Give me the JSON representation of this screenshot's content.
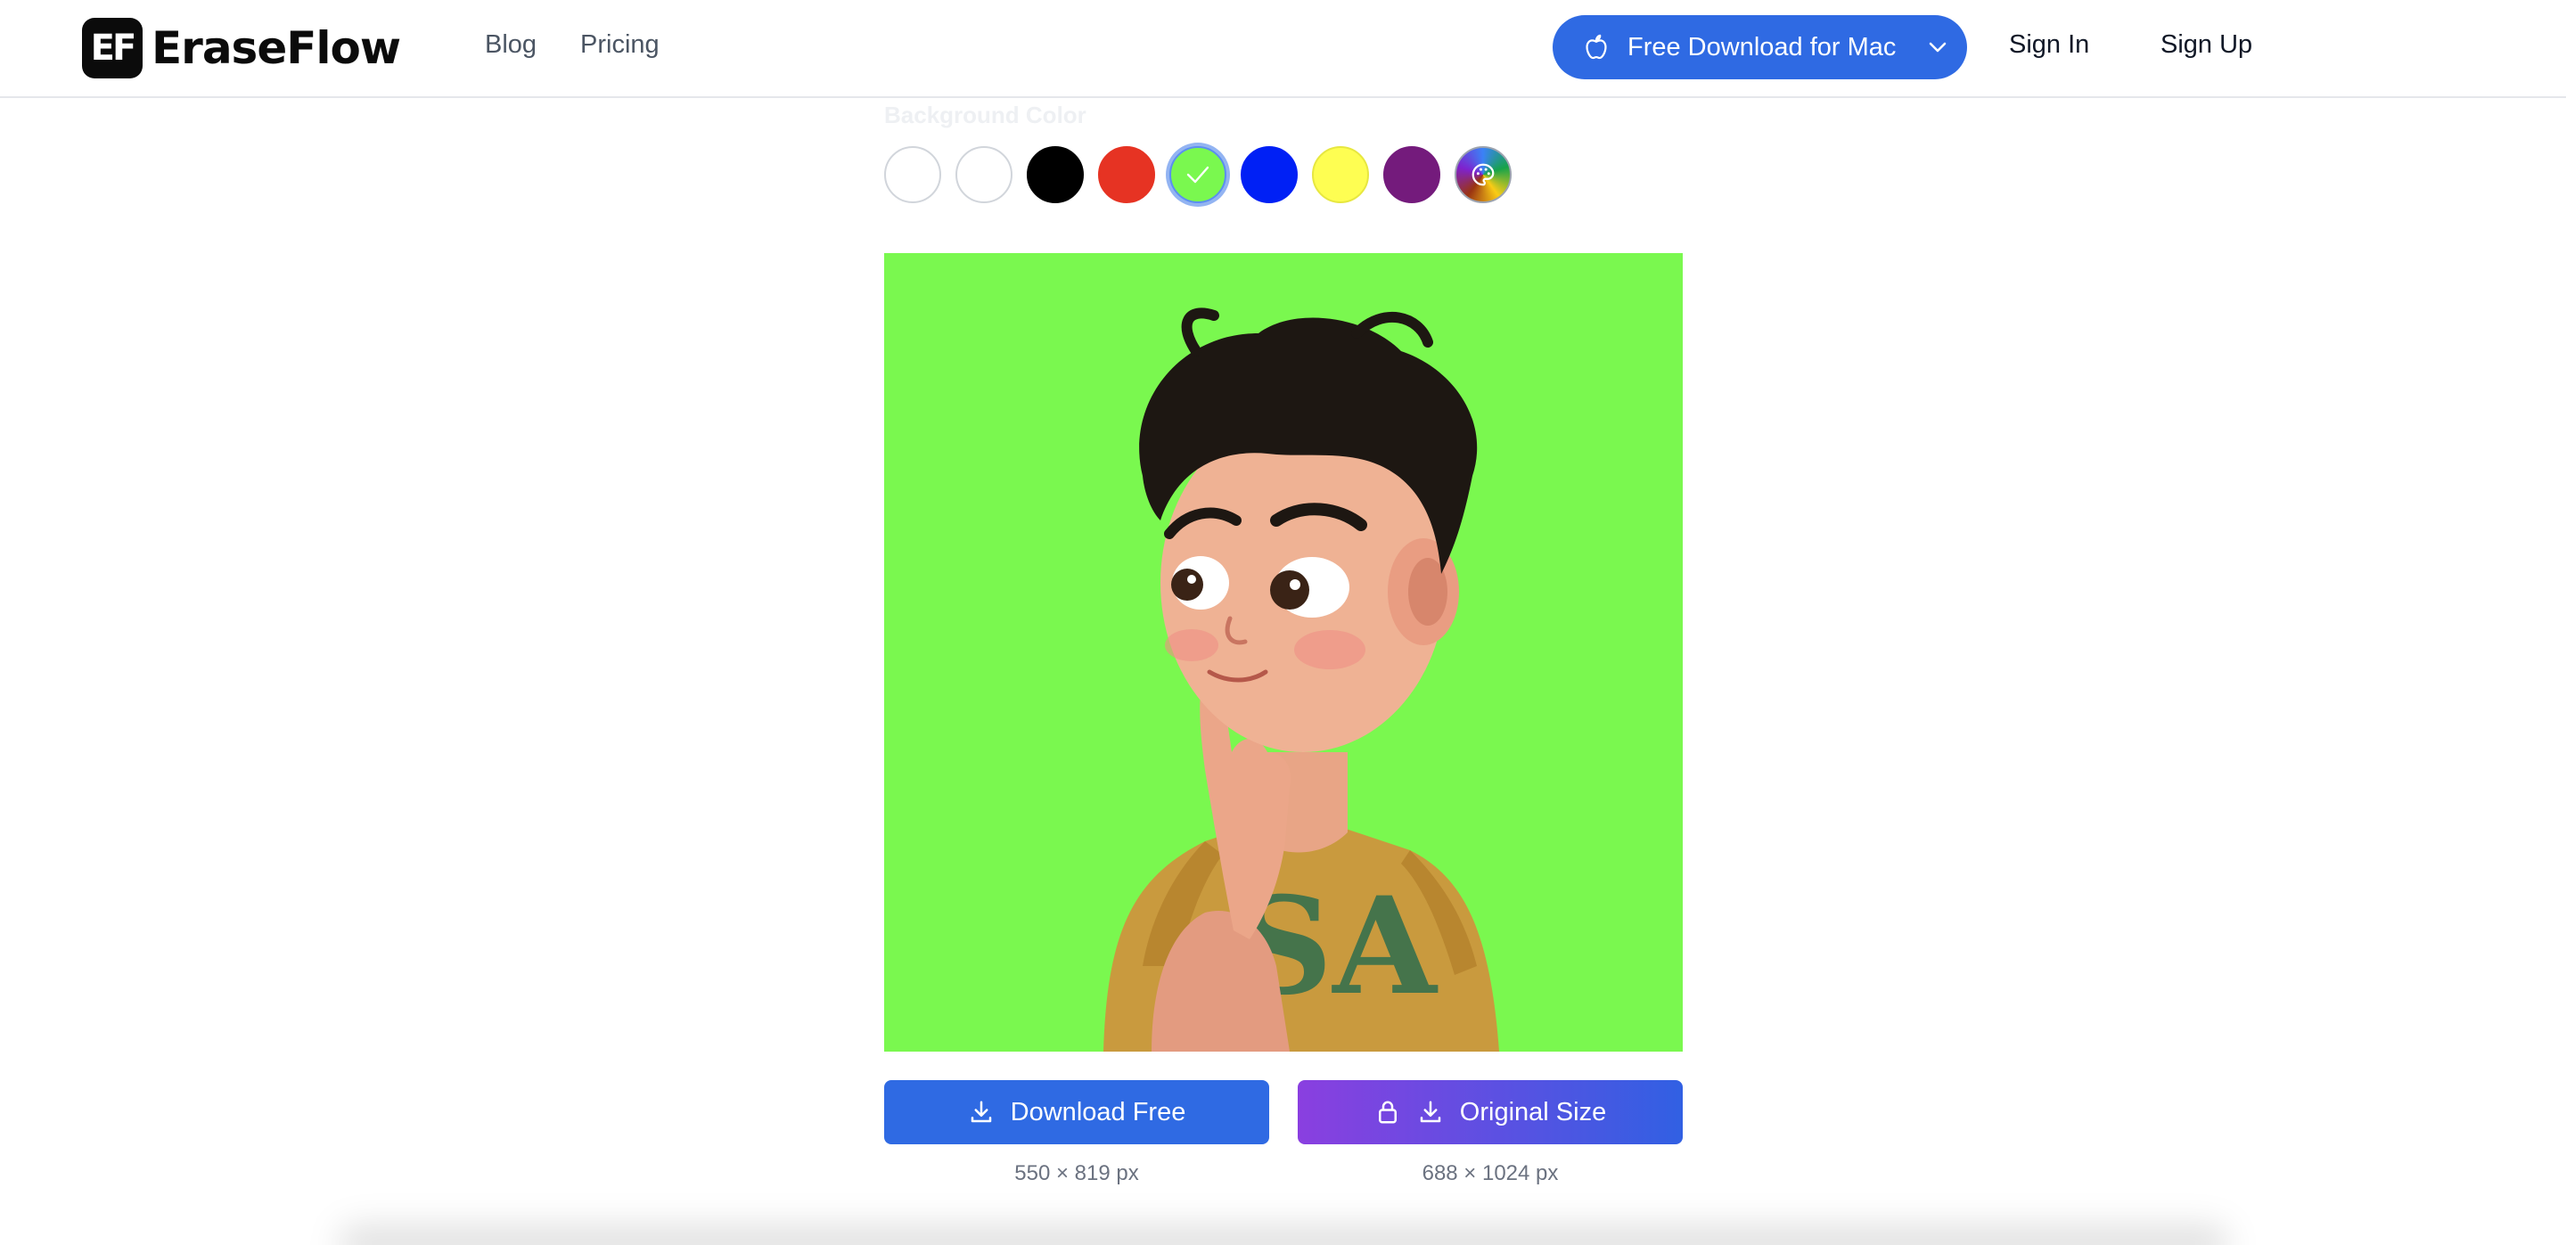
{
  "header": {
    "logo_mark": "EF",
    "logo_text": "EraseFlow",
    "nav": {
      "blog": "Blog",
      "pricing": "Pricing"
    },
    "download_mac_label": "Free Download for Mac",
    "sign_in": "Sign In",
    "sign_up": "Sign Up",
    "accent_color": "#2f6ae3"
  },
  "background_picker": {
    "label": "Background Color",
    "selected_color": "#7af84f",
    "swatches": [
      {
        "name": "transparent",
        "color": "#ffffff"
      },
      {
        "name": "white",
        "color": "#ffffff"
      },
      {
        "name": "black",
        "color": "#000000"
      },
      {
        "name": "red",
        "color": "#e63323"
      },
      {
        "name": "green",
        "color": "#7af84f"
      },
      {
        "name": "blue",
        "color": "#0020f5"
      },
      {
        "name": "yellow",
        "color": "#fefe52"
      },
      {
        "name": "purple",
        "color": "#741b7c"
      },
      {
        "name": "custom",
        "color": "gradient"
      }
    ]
  },
  "preview": {
    "background": "#7af84f"
  },
  "actions": {
    "download_free": "Download Free",
    "download_free_size": "550 × 819 px",
    "original_size": "Original Size",
    "original_size_dims": "688 × 1024 px"
  }
}
